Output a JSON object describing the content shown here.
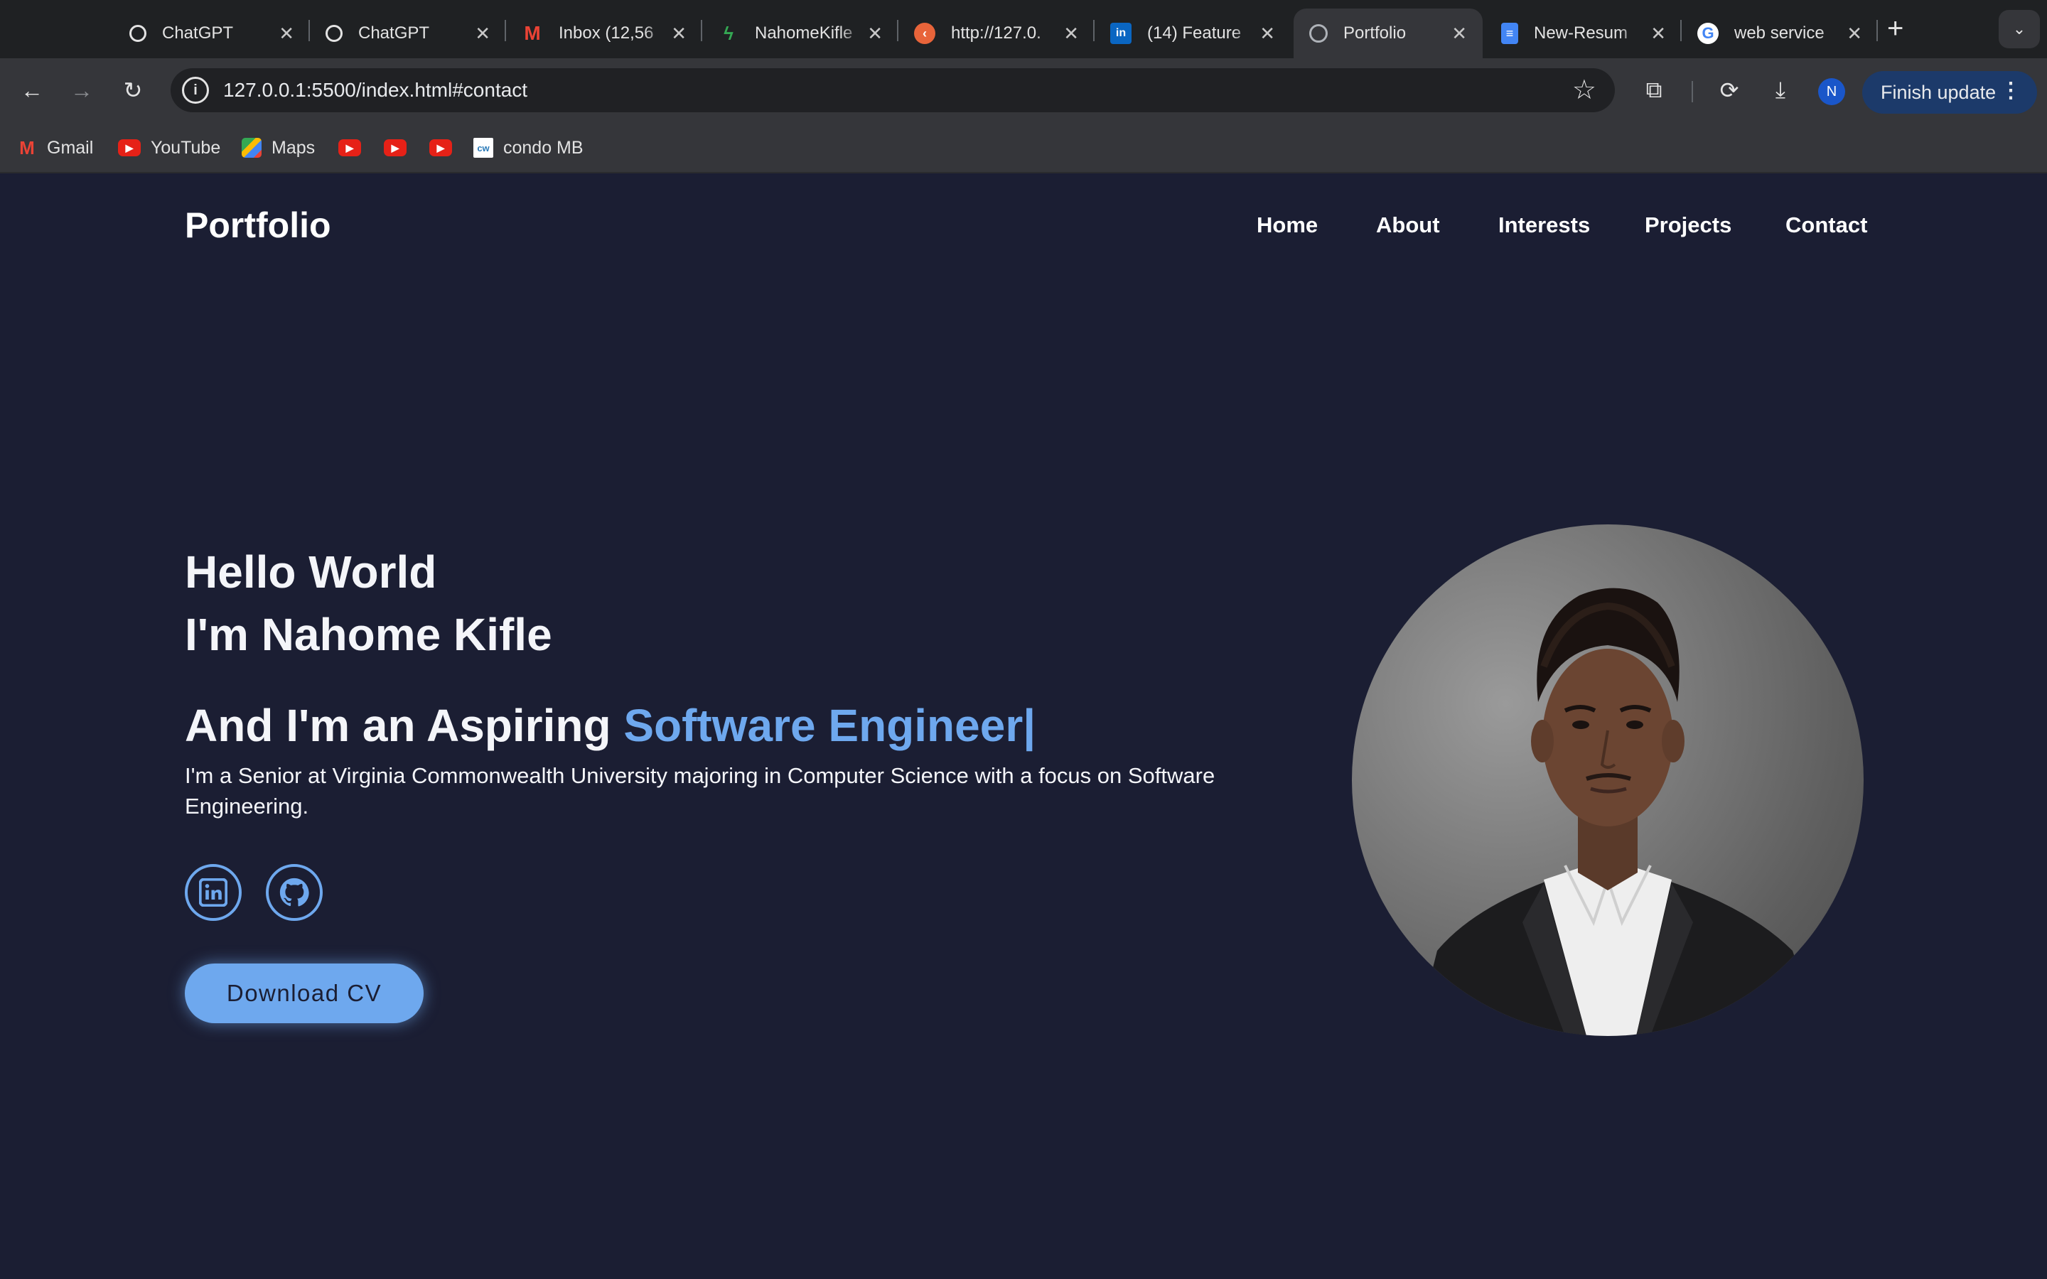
{
  "browser": {
    "tabs": [
      {
        "title": "ChatGPT",
        "icon": "chatgpt-icon"
      },
      {
        "title": "ChatGPT",
        "icon": "chatgpt-icon"
      },
      {
        "title": "Inbox (12,56",
        "icon": "gmail-icon"
      },
      {
        "title": "NahomeKifle",
        "icon": "bolt-icon"
      },
      {
        "title": "http://127.0.",
        "icon": "liveserver-icon"
      },
      {
        "title": "(14) Feature",
        "icon": "linkedin-icon"
      },
      {
        "title": "Portfolio",
        "icon": "globe-icon",
        "active": true
      },
      {
        "title": "New-Resum",
        "icon": "docs-icon"
      },
      {
        "title": "web service",
        "icon": "google-icon"
      }
    ],
    "address": "127.0.0.1:5500/index.html#contact",
    "profile_initial": "N",
    "finish_update_label": "Finish update",
    "bookmarks": [
      {
        "label": "Gmail",
        "icon": "gmail-icon"
      },
      {
        "label": "YouTube",
        "icon": "youtube-icon"
      },
      {
        "label": "Maps",
        "icon": "maps-icon"
      },
      {
        "label": "",
        "icon": "youtube-icon"
      },
      {
        "label": "",
        "icon": "youtube-icon"
      },
      {
        "label": "",
        "icon": "youtube-icon"
      },
      {
        "label": "condo MB",
        "icon": "cw-icon"
      }
    ]
  },
  "site": {
    "logo": "Portfolio",
    "nav": [
      "Home",
      "About",
      "Interests",
      "Projects",
      "Contact"
    ],
    "hero": {
      "greeting": "Hello World",
      "name_line": "I'm Nahome Kifle",
      "role_prefix": "And I'm an Aspiring ",
      "role_highlight": "Software Engineer|",
      "bio": "I'm a Senior at Virginia Commonwealth University majoring in Computer Science with a focus on Software Engineering.",
      "cta": "Download CV",
      "social": [
        "linkedin-icon",
        "github-icon"
      ]
    }
  },
  "colors": {
    "page_background": "#1b1e33",
    "accent": "#6ea8ee",
    "text": "#f4f5f9"
  }
}
